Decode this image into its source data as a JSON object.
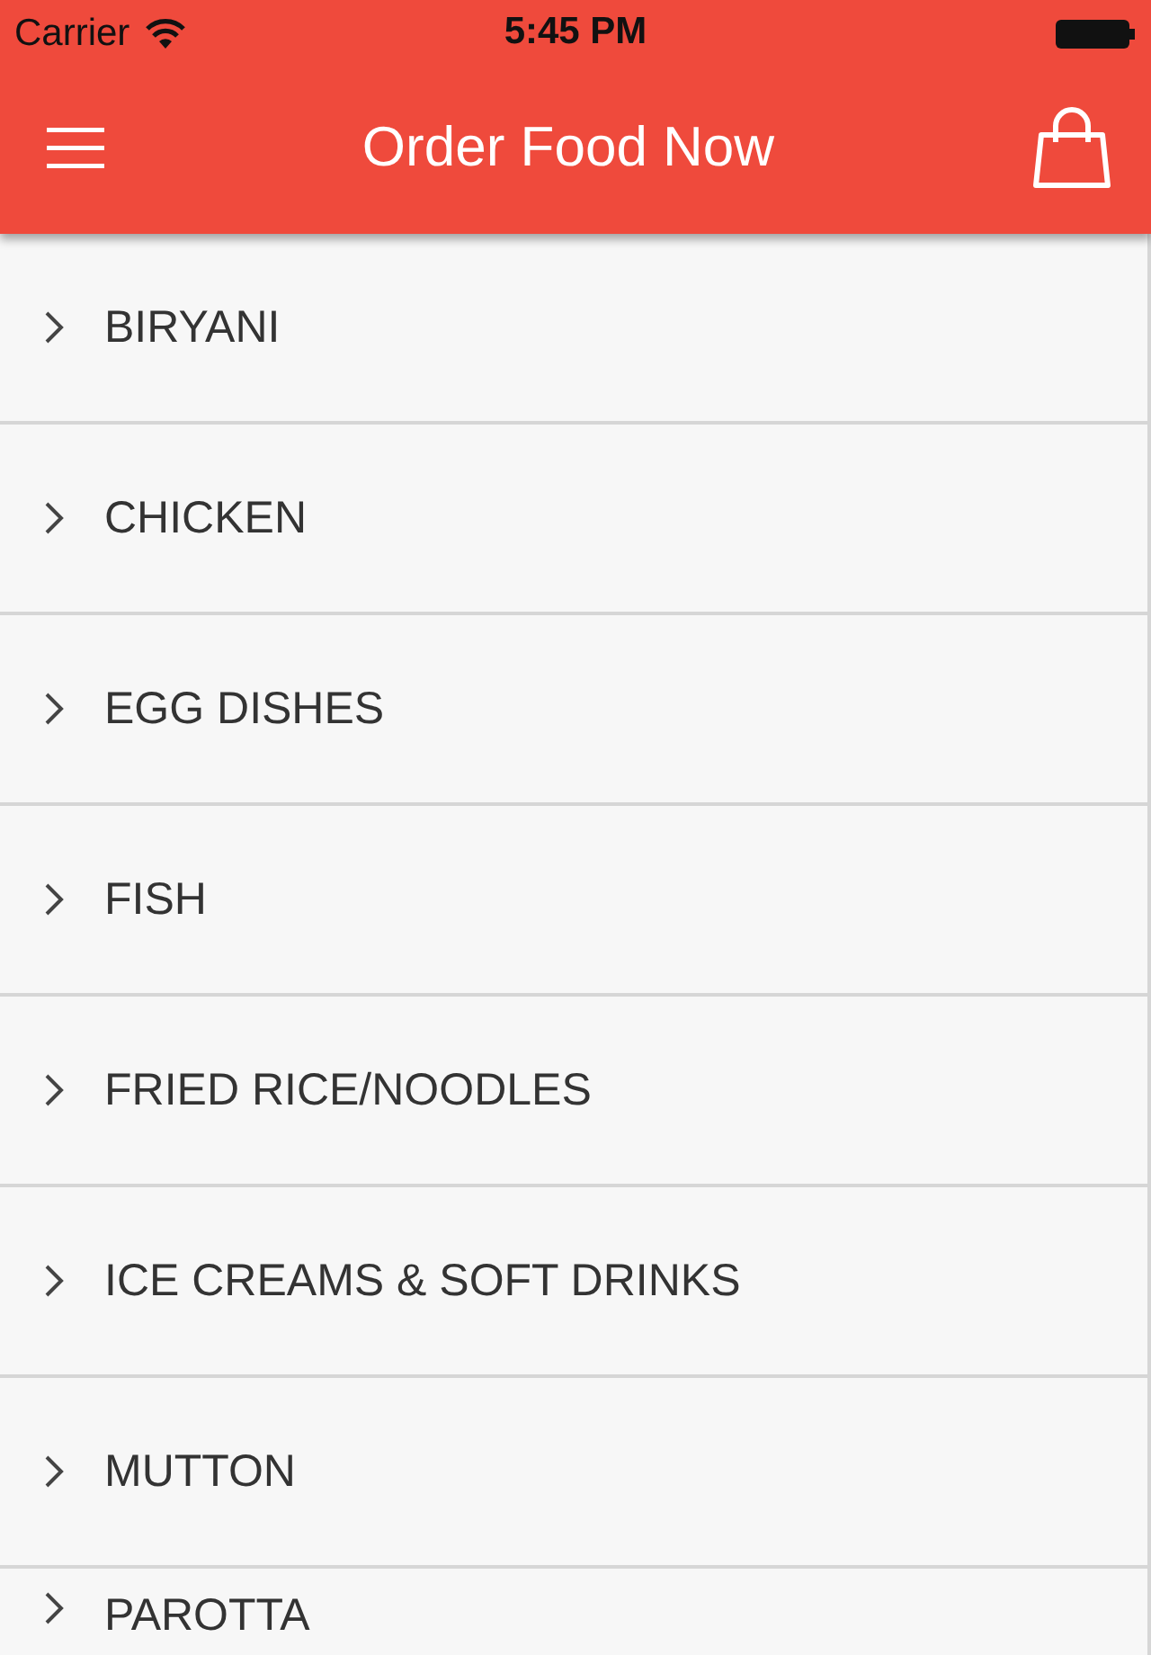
{
  "status_bar": {
    "carrier": "Carrier",
    "time": "5:45 PM"
  },
  "nav_bar": {
    "title": "Order Food Now"
  },
  "categories": [
    {
      "label": "BIRYANI"
    },
    {
      "label": "CHICKEN"
    },
    {
      "label": "EGG DISHES"
    },
    {
      "label": "FISH"
    },
    {
      "label": "FRIED RICE/NOODLES"
    },
    {
      "label": "ICE CREAMS & SOFT DRINKS"
    },
    {
      "label": "MUTTON"
    },
    {
      "label": "PAROTTA"
    }
  ]
}
